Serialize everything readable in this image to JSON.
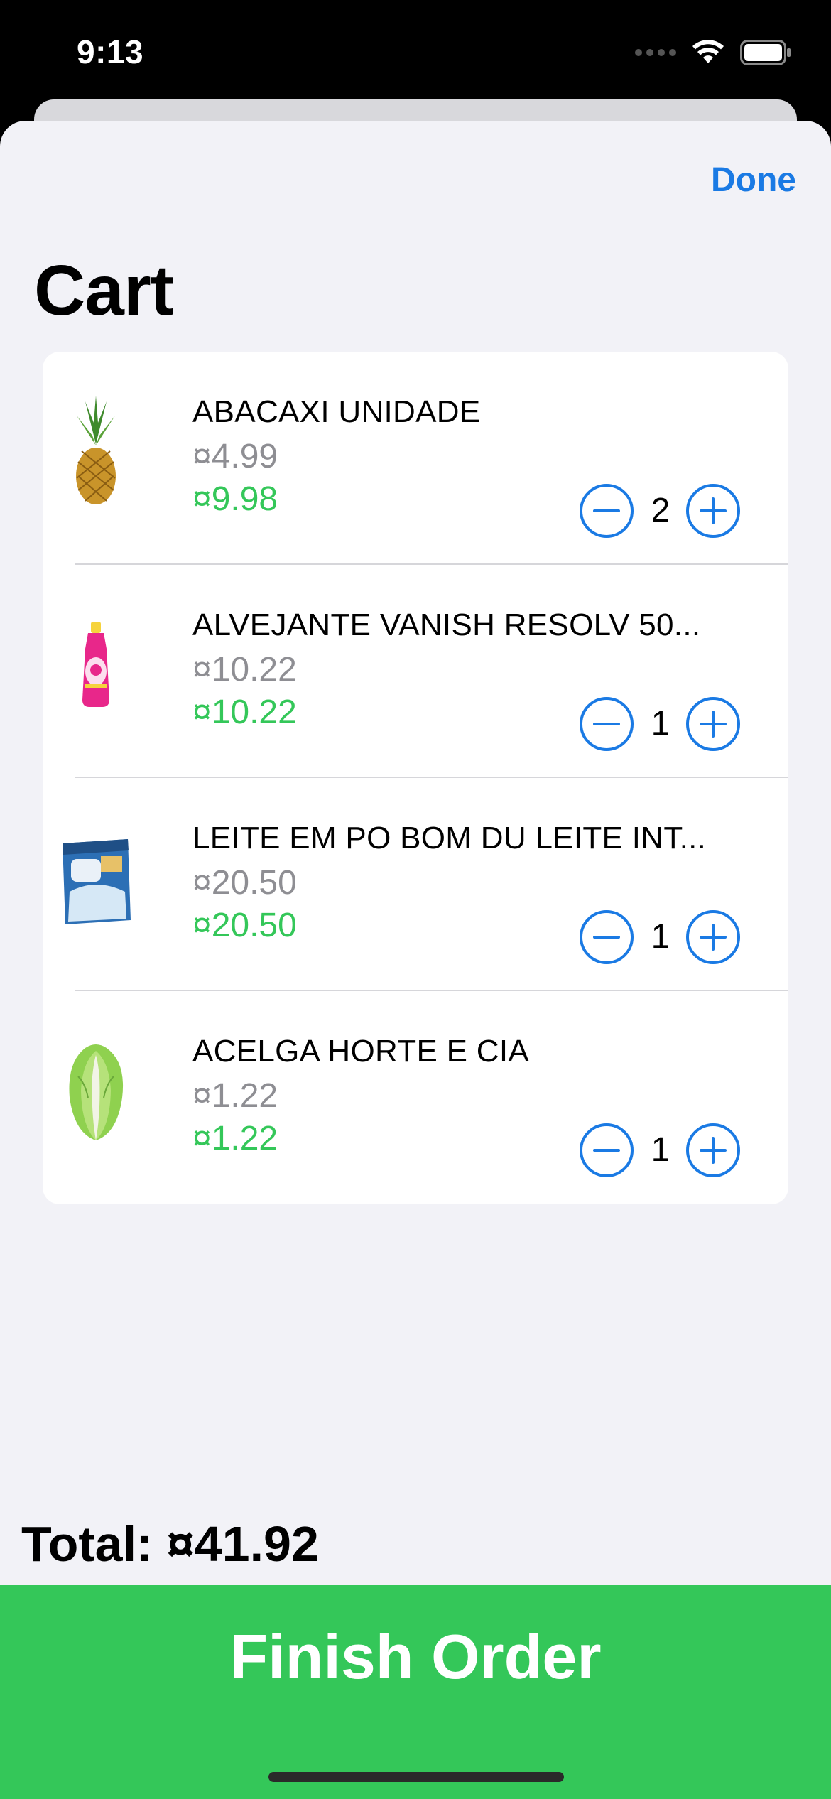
{
  "status_bar": {
    "time": "9:13"
  },
  "nav": {
    "done_label": "Done",
    "title": "Cart"
  },
  "cart": {
    "items": [
      {
        "name": "ABACAXI UNIDADE",
        "unit_price": "¤4.99",
        "line_total": "¤9.98",
        "quantity": "2",
        "image": "pineapple"
      },
      {
        "name": "ALVEJANTE VANISH RESOLV 50...",
        "unit_price": "¤10.22",
        "line_total": "¤10.22",
        "quantity": "1",
        "image": "bleach-bottle"
      },
      {
        "name": "LEITE EM PO BOM DU LEITE INT...",
        "unit_price": "¤20.50",
        "line_total": "¤20.50",
        "quantity": "1",
        "image": "milk-powder-bag"
      },
      {
        "name": "ACELGA HORTE E CIA",
        "unit_price": "¤1.22",
        "line_total": "¤1.22",
        "quantity": "1",
        "image": "chard"
      }
    ]
  },
  "summary": {
    "total_text": "Total: ¤41.92"
  },
  "actions": {
    "finish_label": "Finish Order"
  },
  "colors": {
    "accent": "#1a7ae4",
    "price_green": "#34c759",
    "muted": "#8e8e93",
    "background": "#f2f2f7"
  }
}
